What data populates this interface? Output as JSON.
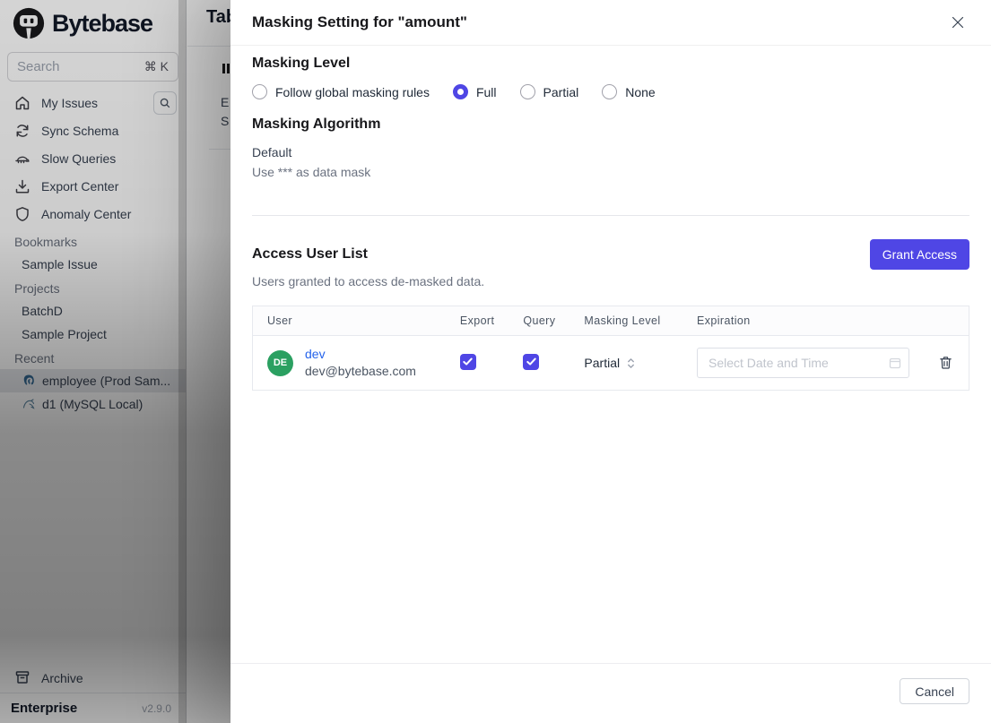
{
  "sidebar": {
    "brand": "Bytebase",
    "search": {
      "placeholder": "Search",
      "shortcut": "⌘ K"
    },
    "nav": [
      {
        "label": "My Issues"
      },
      {
        "label": "Sync Schema"
      },
      {
        "label": "Slow Queries"
      },
      {
        "label": "Export Center"
      },
      {
        "label": "Anomaly Center"
      }
    ],
    "sections": [
      {
        "label": "Bookmarks",
        "items": [
          {
            "label": "Sample Issue"
          }
        ]
      },
      {
        "label": "Projects",
        "items": [
          {
            "label": "BatchD"
          },
          {
            "label": "Sample Project"
          }
        ]
      },
      {
        "label": "Recent",
        "items": [
          {
            "label": "employee (Prod Sam...",
            "selected": true
          },
          {
            "label": "d1 (MySQL Local)",
            "selected": false
          }
        ]
      }
    ],
    "footer": {
      "archive": "Archive",
      "plan": "Enterprise",
      "version": "v2.9.0"
    }
  },
  "background_page": {
    "title_fragment": "Tab",
    "label_fragment_1": "E",
    "label_fragment_2": "S"
  },
  "modal": {
    "title": "Masking Setting for \"amount\"",
    "masking_level": {
      "heading": "Masking Level",
      "options": [
        {
          "label": "Follow global masking rules",
          "selected": false
        },
        {
          "label": "Full",
          "selected": true
        },
        {
          "label": "Partial",
          "selected": false
        },
        {
          "label": "None",
          "selected": false
        }
      ]
    },
    "masking_algorithm": {
      "heading": "Masking Algorithm",
      "name": "Default",
      "description": "Use *** as data mask"
    },
    "access_user_list": {
      "heading": "Access User List",
      "description": "Users granted to access de-masked data.",
      "grant_button": "Grant Access",
      "table": {
        "columns": [
          "User",
          "Export",
          "Query",
          "Masking Level",
          "Expiration"
        ],
        "rows": [
          {
            "avatar": "DE",
            "name": "dev",
            "email": "dev@bytebase.com",
            "export_checked": true,
            "query_checked": true,
            "masking_level": "Partial",
            "expiration_placeholder": "Select Date and Time"
          }
        ]
      }
    },
    "footer": {
      "cancel": "Cancel"
    }
  },
  "colors": {
    "accent": "#4f46e5",
    "avatar_green": "#2ba061",
    "link_blue": "#2563eb"
  }
}
